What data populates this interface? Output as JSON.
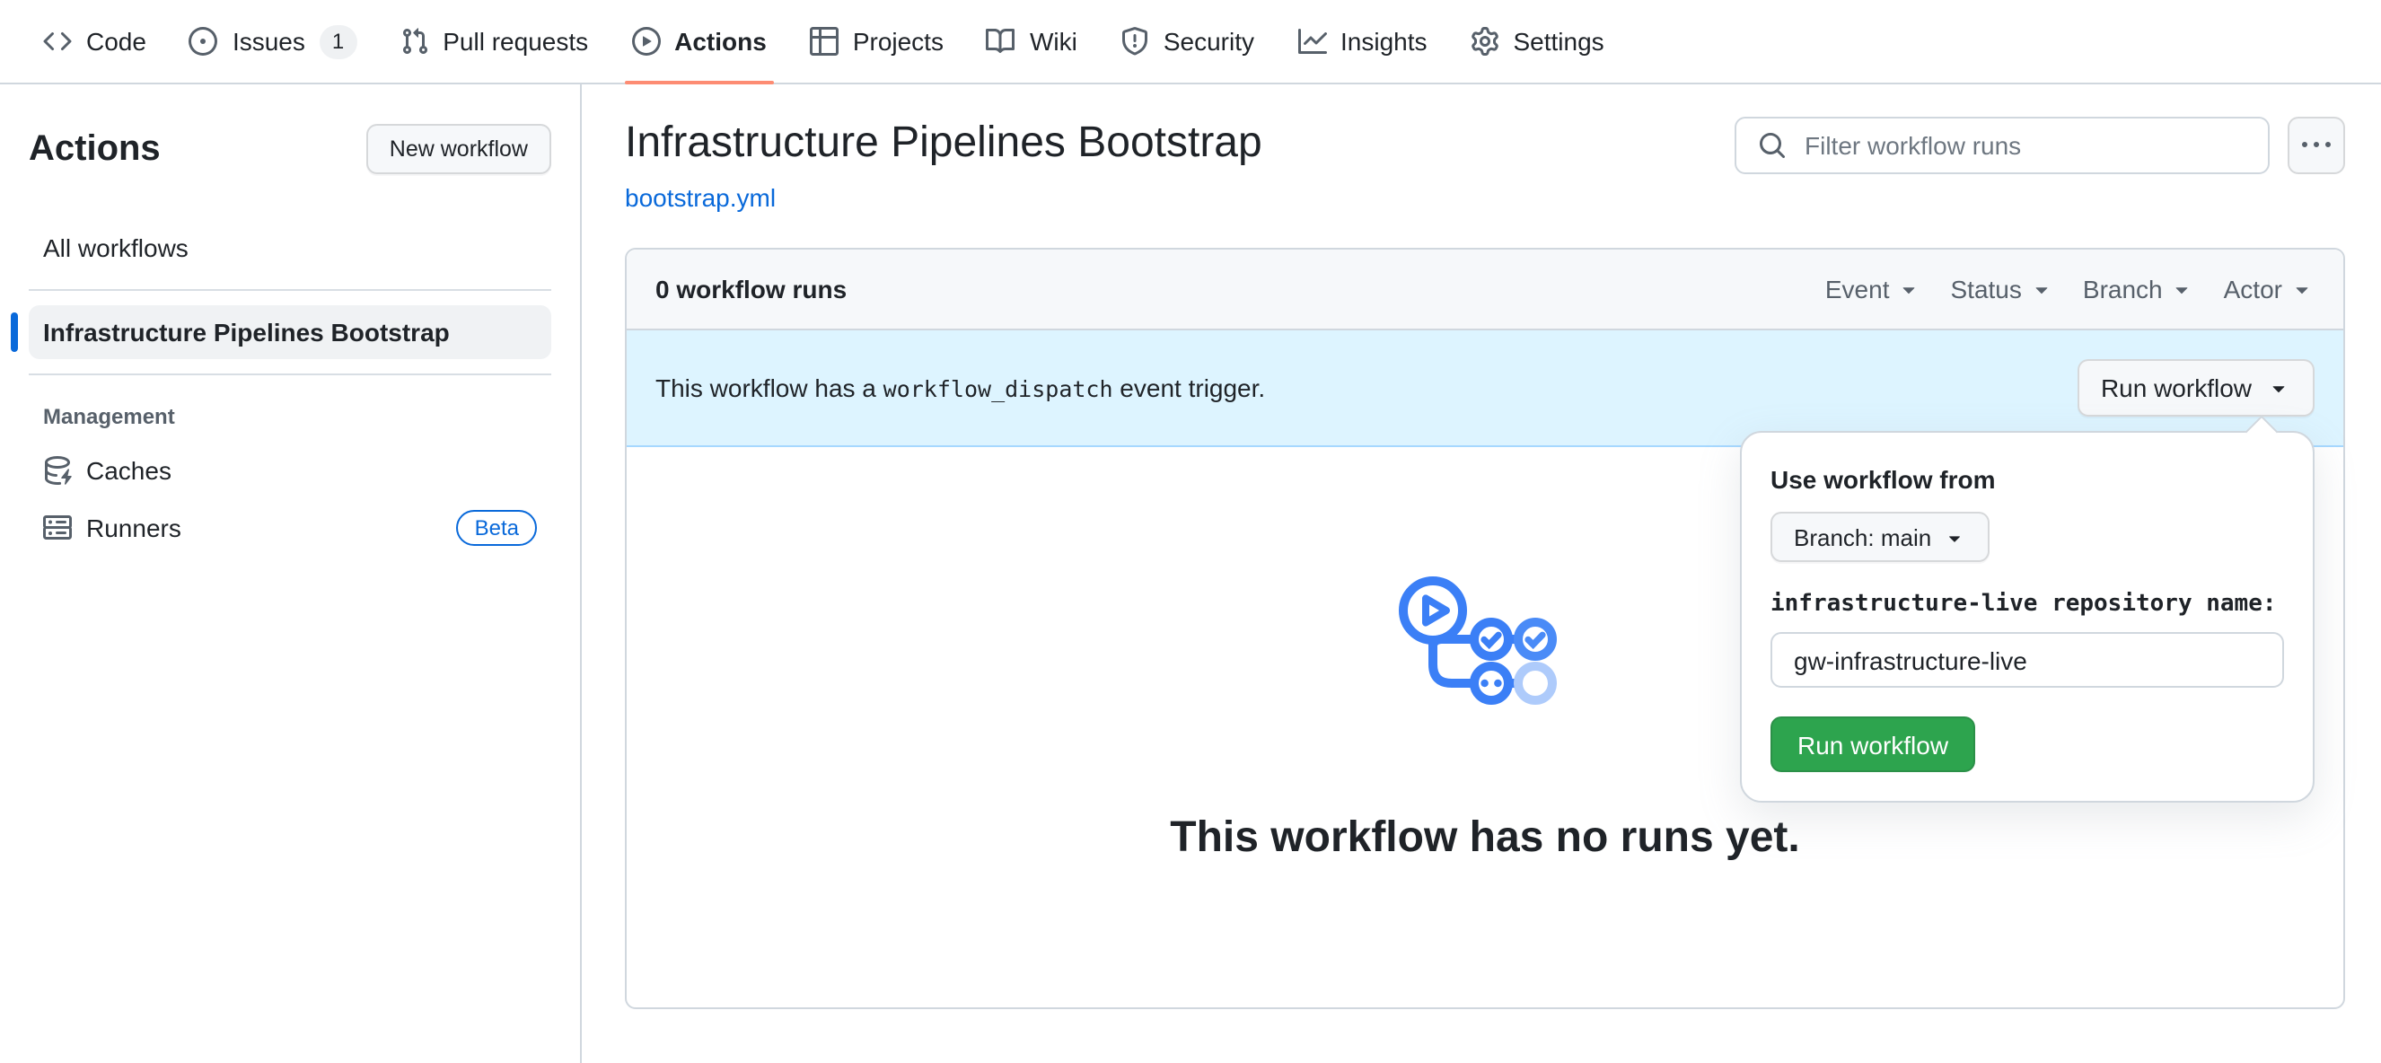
{
  "nav": {
    "items": [
      {
        "label": "Code",
        "icon": "code-icon"
      },
      {
        "label": "Issues",
        "icon": "issue-opened-icon",
        "badge": "1"
      },
      {
        "label": "Pull requests",
        "icon": "pull-request-icon"
      },
      {
        "label": "Actions",
        "icon": "play-icon",
        "active": true
      },
      {
        "label": "Projects",
        "icon": "table-icon"
      },
      {
        "label": "Wiki",
        "icon": "book-icon"
      },
      {
        "label": "Security",
        "icon": "shield-icon"
      },
      {
        "label": "Insights",
        "icon": "graph-icon"
      },
      {
        "label": "Settings",
        "icon": "gear-icon"
      }
    ]
  },
  "sidebar": {
    "title": "Actions",
    "new_workflow_label": "New workflow",
    "all_workflows_label": "All workflows",
    "selected_workflow": "Infrastructure Pipelines Bootstrap",
    "management": {
      "header": "Management",
      "items": [
        {
          "label": "Caches",
          "icon": "cache-icon"
        },
        {
          "label": "Runners",
          "icon": "server-icon",
          "badge": "Beta"
        }
      ]
    }
  },
  "main": {
    "title": "Infrastructure Pipelines Bootstrap",
    "workflow_file": "bootstrap.yml",
    "filter": {
      "placeholder": "Filter workflow runs",
      "icon": "search-icon"
    },
    "more_options_icon": "kebab-horizontal-icon",
    "runs_panel": {
      "header": "0 workflow runs",
      "filters": [
        "Event",
        "Status",
        "Branch",
        "Actor"
      ],
      "banner": {
        "text_before": "This workflow has a ",
        "code": "workflow_dispatch",
        "text_after": " event trigger.",
        "run_button": "Run workflow"
      },
      "empty_title": "This workflow has no runs yet.",
      "empty_icon": "workflow-graph-icon"
    },
    "run_popover": {
      "heading": "Use workflow from",
      "branch_button": "Branch: main",
      "input_label": "infrastructure-live repository name:",
      "input_value": "gw-infrastructure-live",
      "submit_label": "Run workflow"
    }
  },
  "colors": {
    "accent_blue": "#0969da",
    "tab_underline_orange": "#fd8c73",
    "banner_blue": "#ddf4ff",
    "run_button_green": "#2da44e",
    "empty_icon_blue": "#3b7ff6"
  }
}
